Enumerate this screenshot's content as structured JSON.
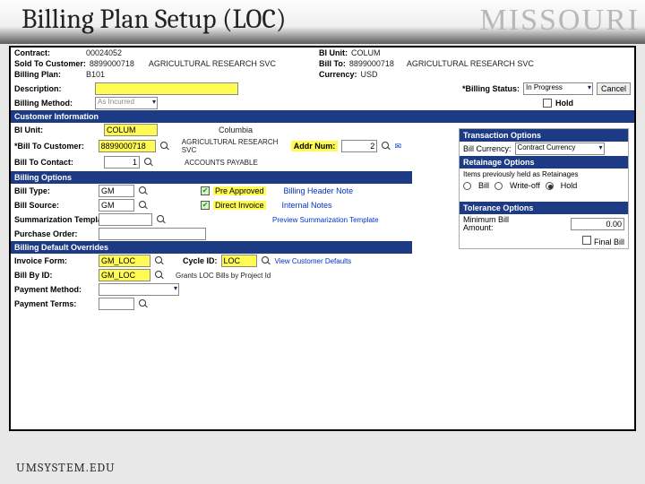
{
  "slide": {
    "title": "Billing Plan Setup (LOC)",
    "watermark": "MISSOURI",
    "footer": "UMSYSTEM.EDU"
  },
  "top": {
    "contract_label": "Contract:",
    "contract": "00024052",
    "bi_unit_label": "BI Unit:",
    "bi_unit": "COLUM",
    "sold_to_label": "Sold To Customer:",
    "sold_to_id": "8899000718",
    "sold_to_name": "AGRICULTURAL RESEARCH SVC",
    "bill_to_label": "Bill To:",
    "bill_to_id": "8899000718",
    "bill_to_name": "AGRICULTURAL RESEARCH SVC",
    "plan_label": "Billing Plan:",
    "plan": "B101",
    "currency_label": "Currency:",
    "currency": "USD",
    "description_label": "Description:",
    "status_label": "*Billing Status:",
    "status": "In Progress",
    "method_label": "Billing Method:",
    "method": "As Incurred",
    "hold_label": "Hold",
    "cancel": "Cancel"
  },
  "cust_header": "Customer Information",
  "cust": {
    "bi_unit_label": "BI Unit:",
    "bi_unit": "COLUM",
    "bi_unit_desc": "Columbia",
    "bill_to_cust_label": "*Bill To Customer:",
    "bill_to_cust": "8899000718",
    "bill_to_cust_name": "AGRICULTURAL RESEARCH SVC",
    "addr_num_label": "Addr Num:",
    "addr_num": "2",
    "bill_to_contact_label": "Bill To Contact:",
    "bill_to_contact": "1",
    "bill_to_contact_name": "ACCOUNTS PAYABLE"
  },
  "opts_header": "Billing Options",
  "opts": {
    "bill_type_label": "Bill Type:",
    "bill_type": "GM",
    "pre_approved_label": "Pre Approved",
    "bill_source_label": "Bill Source:",
    "bill_source": "GM",
    "direct_invoice_label": "Direct Invoice",
    "summ_tmpl_label": "Summarization Template ID:",
    "po_label": "Purchase Order:",
    "note1": "Billing Header Note",
    "note2": "Internal Notes",
    "note3": "Preview Summarization Template"
  },
  "over_header": "Billing Default Overrides",
  "over": {
    "invoice_form_label": "Invoice Form:",
    "invoice_form": "GM_LOC",
    "cycle_id_label": "Cycle ID:",
    "cycle_id": "LOC",
    "view_defaults": "View Customer Defaults",
    "bill_by_label": "Bill By ID:",
    "bill_by": "GM_LOC",
    "bill_by_desc": "Grants LOC Bills by Project Id",
    "pay_method_label": "Payment Method:",
    "pay_terms_label": "Payment Terms:"
  },
  "trans_header": "Transaction Options",
  "trans": {
    "bill_curr_label": "Bill Currency:",
    "bill_curr": "Contract Currency"
  },
  "ret_header": "Retainage Options",
  "ret": {
    "prev_held": "Items previously held as Retainages",
    "bill": "Bill",
    "writeoff": "Write-off",
    "hold": "Hold"
  },
  "tol_header": "Tolerance Options",
  "tol": {
    "min_label": "Minimum Bill Amount:",
    "min_val": "0.00",
    "final_label": "Final Bill"
  }
}
